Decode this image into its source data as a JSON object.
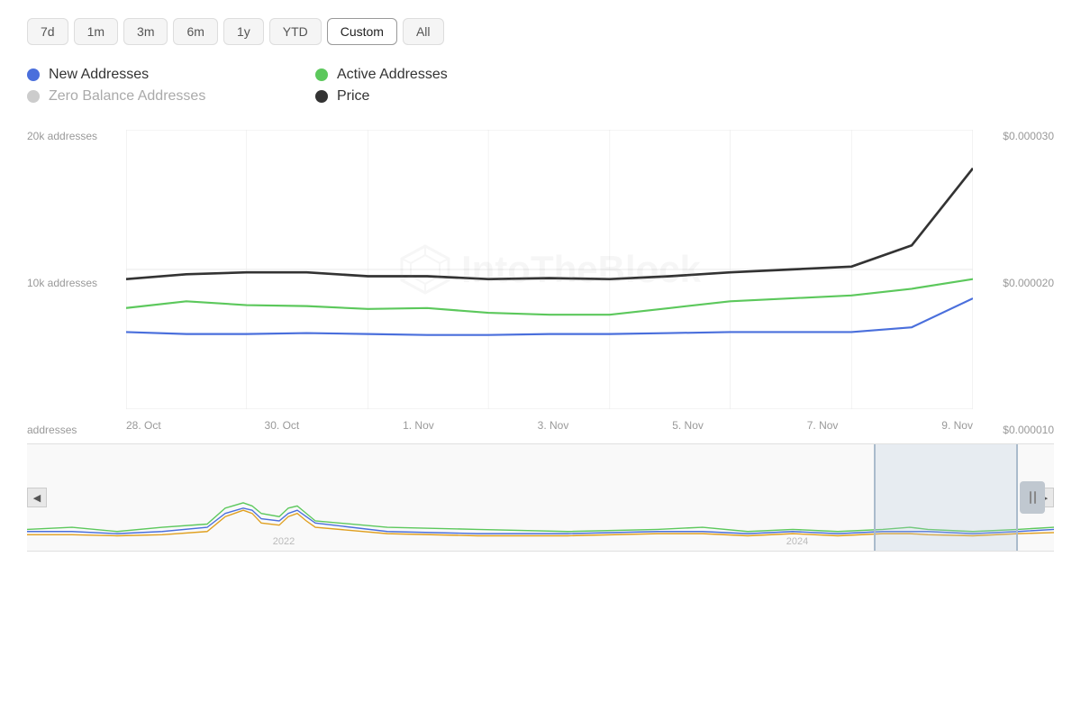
{
  "timeFilters": {
    "buttons": [
      "7d",
      "1m",
      "3m",
      "6m",
      "1y",
      "YTD",
      "Custom",
      "All"
    ],
    "active": "Custom"
  },
  "legend": [
    {
      "id": "new-addresses",
      "label": "New Addresses",
      "color": "#4a6fdc",
      "muted": false
    },
    {
      "id": "active-addresses",
      "label": "Active Addresses",
      "color": "#5cc85c",
      "muted": false
    },
    {
      "id": "zero-balance",
      "label": "Zero Balance Addresses",
      "color": "#cccccc",
      "muted": true
    },
    {
      "id": "price",
      "label": "Price",
      "color": "#333333",
      "muted": false
    }
  ],
  "chart": {
    "yAxisLeft": [
      "20k addresses",
      "10k addresses",
      "addresses"
    ],
    "yAxisRight": [
      "$0.000030",
      "$0.000020",
      "$0.000010"
    ],
    "xAxisLabels": [
      "28. Oct",
      "30. Oct",
      "1. Nov",
      "3. Nov",
      "5. Nov",
      "7. Nov",
      "9. Nov"
    ],
    "watermark": "IntoTheBlock"
  },
  "navigator": {
    "yearLabels": [
      "2022",
      "2024"
    ]
  }
}
